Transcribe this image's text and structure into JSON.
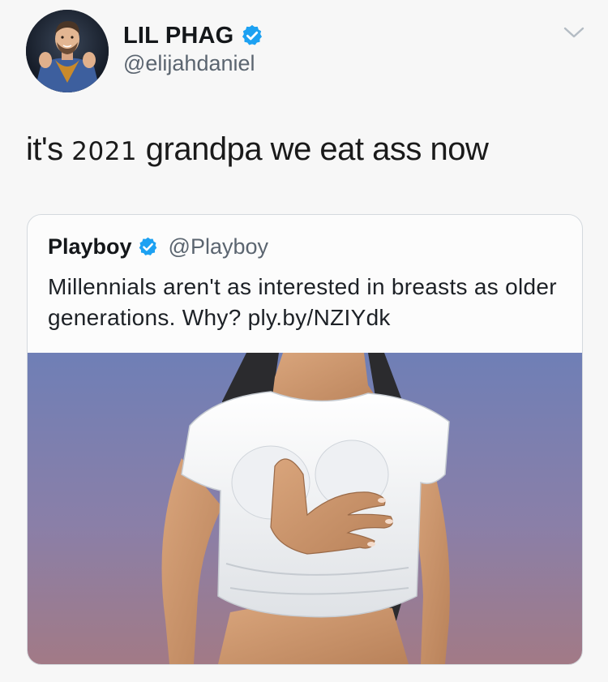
{
  "tweet": {
    "display_name": "LIL PHAG",
    "handle": "@elijahdaniel",
    "text_before": "it's ",
    "text_year": "2021",
    "text_after": " grandpa we eat ass now"
  },
  "quoted_tweet": {
    "display_name": "Playboy",
    "handle": "@Playboy",
    "text": "Millennials aren't as interested in breasts as older generations. Why? ply.by/NZIYdk"
  },
  "icons": {
    "verified": "verified-badge-icon",
    "caret": "chevron-down-icon"
  },
  "colors": {
    "verified_blue": "#1da1f2",
    "background": "#f7f7f7",
    "media_gradient_top": "#6f7fb6",
    "media_gradient_bottom": "#a27a86"
  }
}
